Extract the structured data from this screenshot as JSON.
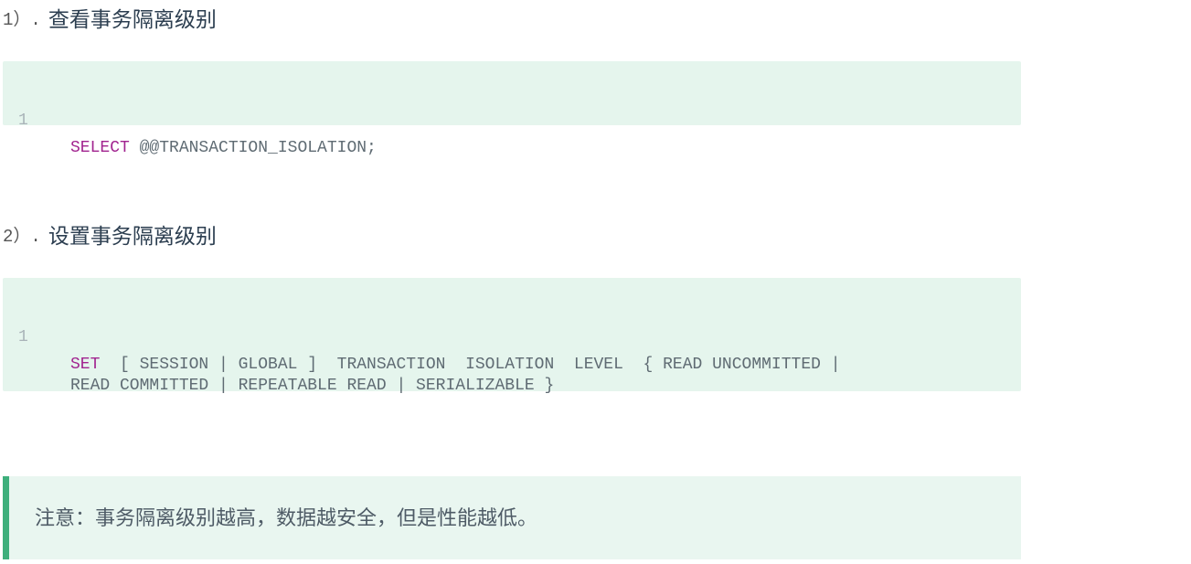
{
  "section1": {
    "number": "1）.",
    "title": "查看事务隔离级别",
    "code": {
      "line_number": "1",
      "keyword": "SELECT",
      "rest": " @@TRANSACTION_ISOLATION;"
    }
  },
  "section2": {
    "number": "2）.",
    "title": "设置事务隔离级别",
    "code": {
      "line_number": "1",
      "keyword": "SET",
      "line1_rest": "  [ SESSION | GLOBAL ]  TRANSACTION  ISOLATION  LEVEL  { READ UNCOMMITTED |",
      "line2": "READ COMMITTED | REPEATABLE READ | SERIALIZABLE }"
    }
  },
  "note": {
    "text": "注意：事务隔离级别越高，数据越安全，但是性能越低。"
  },
  "colors": {
    "code_background": "#e5f5ed",
    "keyword": "#a1238f",
    "note_border": "#3eaf7c",
    "note_background": "#e9f6f0"
  }
}
